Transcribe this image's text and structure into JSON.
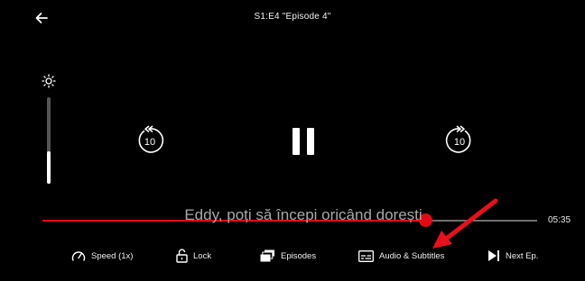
{
  "header": {
    "title": "S1:E4 \"Episode 4\"",
    "back_icon": "arrow-left-icon"
  },
  "brightness": {
    "icon": "sun-icon",
    "level": 0.38
  },
  "playback": {
    "rewind_seconds": "10",
    "forward_seconds": "10",
    "state": "playing",
    "progress_fraction": 0.774,
    "time_remaining": "05:35"
  },
  "subtitle": {
    "text": "Eddy, poți să începi oricând dorești"
  },
  "controls": [
    {
      "label": "Speed (1x)",
      "icon": "speedometer-icon"
    },
    {
      "label": "Lock",
      "icon": "unlock-icon"
    },
    {
      "label": "Episodes",
      "icon": "episodes-icon"
    },
    {
      "label": "Audio & Subtitles",
      "icon": "subtitles-icon"
    },
    {
      "label": "Next Ep.",
      "icon": "next-episode-icon"
    }
  ],
  "colors": {
    "accent": "#e50914",
    "background": "#000000",
    "annotation_arrow": "#e8101c"
  }
}
